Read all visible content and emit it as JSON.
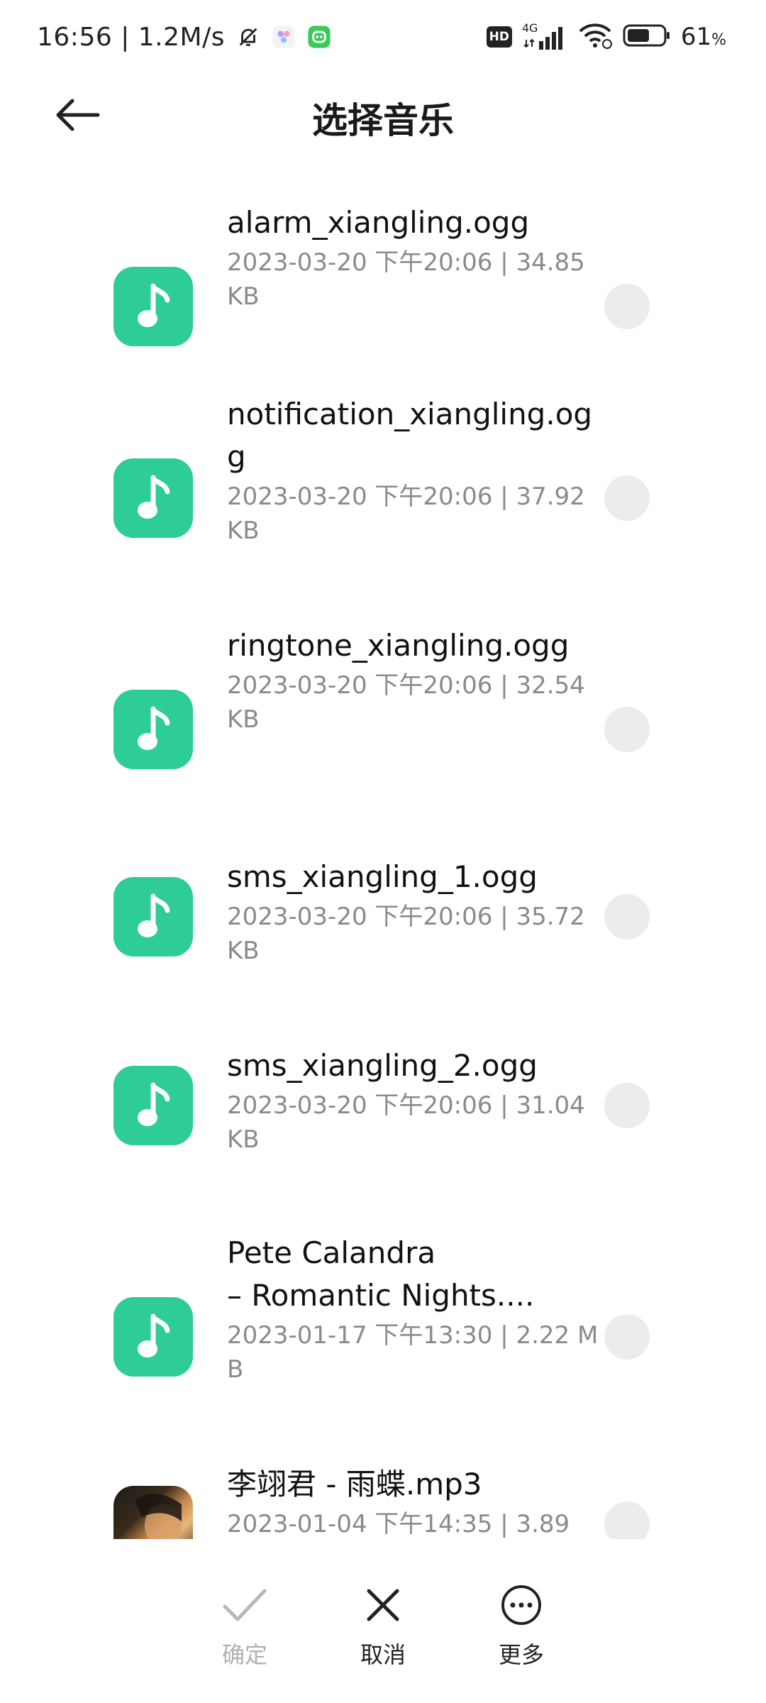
{
  "status_bar": {
    "time_speed": "16:56 | 1.2M/s",
    "hd": "HD",
    "network": "4G",
    "battery": "61",
    "battery_unit": "%"
  },
  "header": {
    "title": "选择音乐",
    "back_icon": "arrow-left-icon"
  },
  "files": [
    {
      "name": "alarm_xiangling.ogg",
      "meta": "2023-03-20 下午20:06 | 34.85 KB",
      "icon": "music-note-icon"
    },
    {
      "name": "notification_xiangling.ogg",
      "meta": "2023-03-20 下午20:06 | 37.92 KB",
      "icon": "music-note-icon"
    },
    {
      "name": "ringtone_xiangling.ogg",
      "meta": "2023-03-20 下午20:06 | 32.54 KB",
      "icon": "music-note-icon"
    },
    {
      "name": "sms_xiangling_1.ogg",
      "meta": "2023-03-20 下午20:06 | 35.72 KB",
      "icon": "music-note-icon"
    },
    {
      "name": "sms_xiangling_2.ogg",
      "meta": "2023-03-20 下午20:06 | 31.04 KB",
      "icon": "music-note-icon"
    },
    {
      "name": "Pete Calandra\n– Romantic Nights....",
      "meta": "2023-01-17 下午13:30 | 2.22 MB",
      "icon": "music-note-icon"
    },
    {
      "name": "李翊君 - 雨蝶.mp3",
      "meta": "2023-01-04 下午14:35 | 3.89",
      "icon": "album-cover-thumbnail"
    }
  ],
  "actions": {
    "confirm": "确定",
    "cancel": "取消",
    "more": "更多"
  },
  "colors": {
    "accent": "#2ecc96",
    "radio": "#ececec",
    "meta_text": "#8a8a8a",
    "disabled": "#b0b0b0"
  }
}
